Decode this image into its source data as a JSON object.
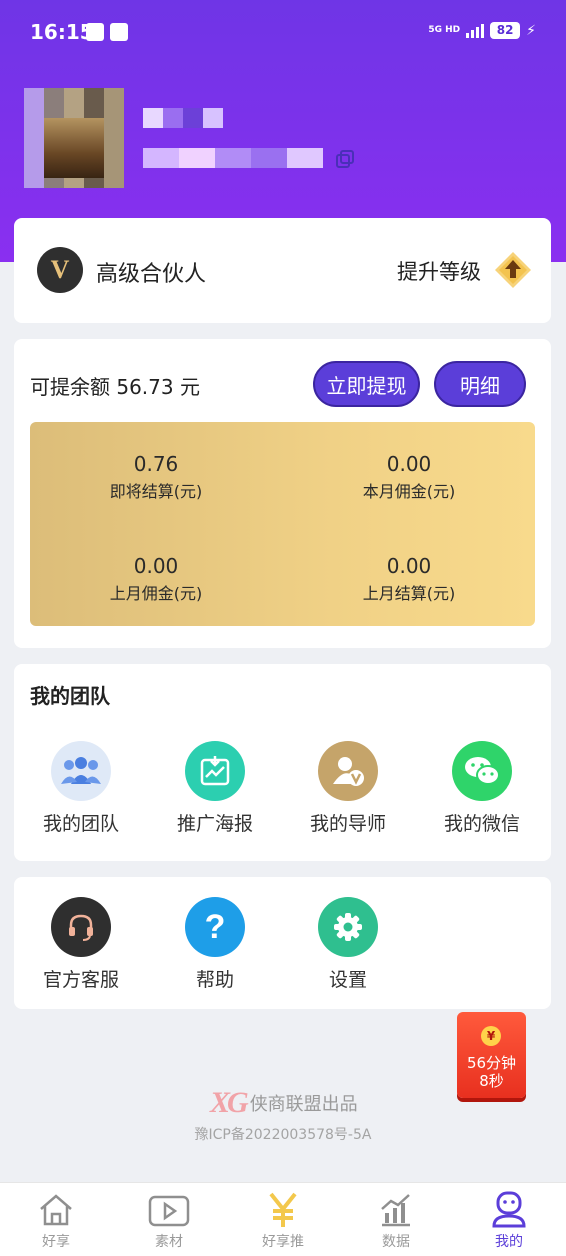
{
  "status": {
    "time": "16:15",
    "network": "5G HD",
    "battery": "82"
  },
  "profile": {
    "name_blurred": "",
    "id_blurred": ""
  },
  "level": {
    "badge_letter": "V",
    "name": "高级合伙人",
    "upgrade_label": "提升等级"
  },
  "balance": {
    "label": "可提余额 56.73 元",
    "withdraw_button": "立即提现",
    "detail_button": "明细",
    "stats": [
      {
        "value": "0.76",
        "label": "即将结算(元)"
      },
      {
        "value": "0.00",
        "label": "本月佣金(元)"
      },
      {
        "value": "0.00",
        "label": "上月佣金(元)"
      },
      {
        "value": "0.00",
        "label": "上月结算(元)"
      }
    ]
  },
  "team": {
    "title": "我的团队",
    "items": [
      {
        "label": "我的团队",
        "icon": "team-icon"
      },
      {
        "label": "推广海报",
        "icon": "poster-icon"
      },
      {
        "label": "我的导师",
        "icon": "mentor-icon"
      },
      {
        "label": "我的微信",
        "icon": "wechat-icon"
      }
    ]
  },
  "service": {
    "items": [
      {
        "label": "官方客服",
        "icon": "headset-icon"
      },
      {
        "label": "帮助",
        "icon": "help-icon"
      },
      {
        "label": "设置",
        "icon": "settings-icon"
      }
    ]
  },
  "red_packet": {
    "coin": "¥",
    "line1": "56分钟",
    "line2": "8秒"
  },
  "footer": {
    "logo": "XG",
    "brand": "侠商联盟出品",
    "icp": "豫ICP备2022003578号-5A"
  },
  "tabs": [
    {
      "label": "好享",
      "icon": "home-icon"
    },
    {
      "label": "素材",
      "icon": "video-icon"
    },
    {
      "label": "好享推",
      "icon": "yen-icon"
    },
    {
      "label": "数据",
      "icon": "chart-icon"
    },
    {
      "label": "我的",
      "icon": "profile-icon",
      "active": true
    }
  ],
  "colors": {
    "header_purple": "#7a33ea",
    "button_purple": "#5b3ed9",
    "gold": "#f0d186"
  }
}
